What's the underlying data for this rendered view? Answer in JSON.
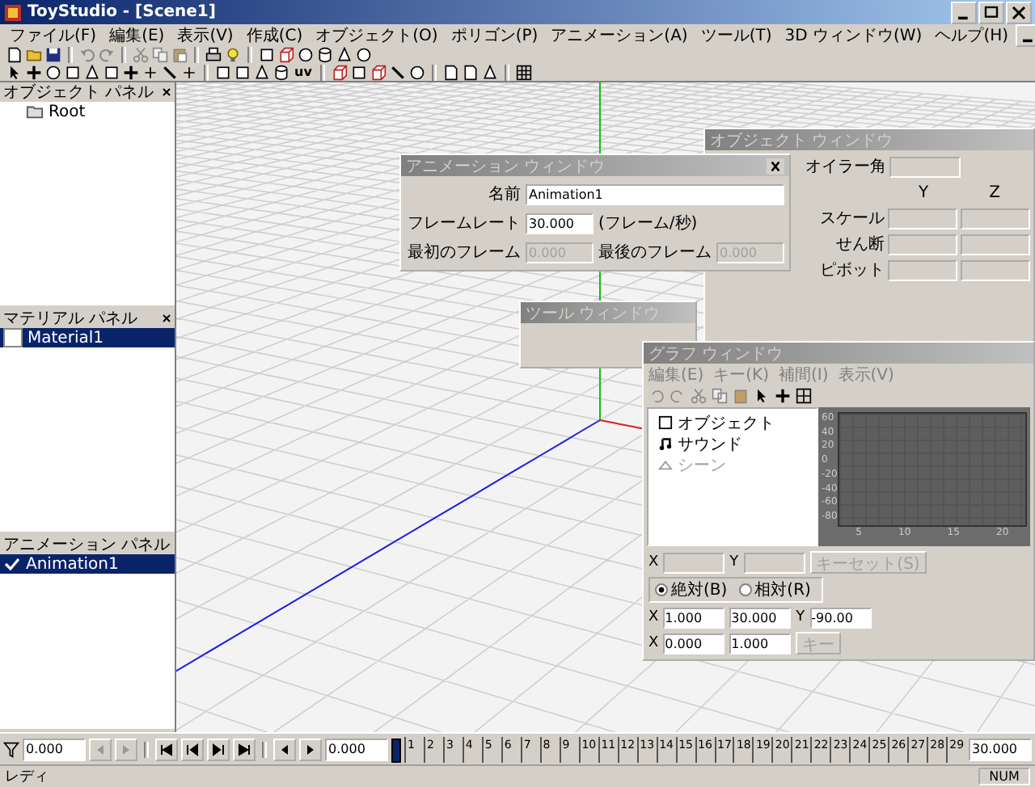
{
  "window": {
    "title": "ToyStudio - [Scene1]"
  },
  "menu": [
    "ファイル(F)",
    "編集(E)",
    "表示(V)",
    "作成(C)",
    "オブジェクト(O)",
    "ポリゴン(P)",
    "アニメーション(A)",
    "ツール(T)",
    "3D ウィンドウ(W)",
    "ヘルプ(H)"
  ],
  "toolbar": {
    "uv_label": "uv"
  },
  "panels": [
    {
      "title": "オブジェクト パネル",
      "items": [
        {
          "label": "Root",
          "kind": "folder",
          "selected": false
        }
      ]
    },
    {
      "title": "マテリアル パネル",
      "items": [
        {
          "label": "Material1",
          "kind": "swatch",
          "selected": true
        }
      ]
    },
    {
      "title": "アニメーション パネル",
      "items": [
        {
          "label": "Animation1",
          "kind": "check",
          "checked": true,
          "selected": true
        }
      ]
    }
  ],
  "object_window": {
    "title": "オブジェクト ウィンドウ",
    "euler_label": "オイラー角",
    "columns": [
      "Y",
      "Z"
    ],
    "rows": [
      "スケール",
      "せん断",
      "ピボット"
    ]
  },
  "animation_window": {
    "title": "アニメーション ウィンドウ",
    "fields": [
      {
        "label": "名前",
        "value": "Animation1",
        "disabled": false
      },
      {
        "label": "フレームレート",
        "value": "30.000",
        "unit": "(フレーム/秒)",
        "disabled": false
      },
      {
        "label": "最初のフレーム",
        "value": "0.000",
        "disabled": true
      },
      {
        "label": "最後のフレーム",
        "value": "0.000",
        "disabled": true
      }
    ]
  },
  "tool_window": {
    "title": "ツール ウィンドウ"
  },
  "graph_window": {
    "title": "グラフ ウィンドウ",
    "menu": [
      "編集(E)",
      "キー(K)",
      "補間(I)",
      "表示(V)"
    ],
    "tree": [
      {
        "label": "オブジェクト",
        "kind": "object",
        "disabled": false
      },
      {
        "label": "サウンド",
        "kind": "sound",
        "disabled": false
      },
      {
        "label": "シーン",
        "kind": "scene",
        "disabled": true
      }
    ],
    "y_ticks": [
      "60",
      "40",
      "20",
      "0",
      "-20",
      "-40",
      "-60",
      "-80"
    ],
    "x_ticks": [
      "5",
      "10",
      "15",
      "20"
    ],
    "key_x_label": "X",
    "key_y_label": "Y",
    "set_key_button": {
      "label": "キーセット(S)",
      "disabled": true
    },
    "range_x_label": "X",
    "range_x_from": "1.000",
    "range_x_to": "30.000",
    "range_y_label": "Y",
    "range_y_from": "-90.00",
    "modes": [
      {
        "label": "絶対(B)",
        "selected": true
      },
      {
        "label": "相対(R)",
        "selected": false
      }
    ],
    "scale_x_label": "X",
    "scale_x_from": "0.000",
    "scale_x_to": "1.000",
    "key_button": {
      "label": "キー",
      "disabled": true
    }
  },
  "timeline": {
    "start": "0.000",
    "current": "0.000",
    "end": "30.000",
    "level": 0,
    "ticks": [
      "1",
      "2",
      "3",
      "4",
      "5",
      "6",
      "7",
      "8",
      "9",
      "10",
      "11",
      "12",
      "13",
      "14",
      "15",
      "16",
      "17",
      "18",
      "19",
      "20",
      "21",
      "22",
      "23",
      "24",
      "25",
      "26",
      "27",
      "28",
      "29"
    ]
  },
  "status_bar": {
    "text": "レディ",
    "indicators": [
      "NUM"
    ]
  }
}
